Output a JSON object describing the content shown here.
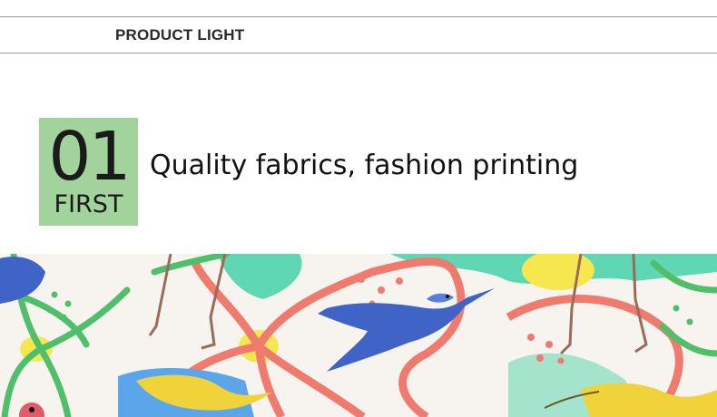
{
  "header": {
    "section_title": "PRODUCT LIGHT"
  },
  "feature": {
    "number": "01",
    "label": "FIRST",
    "headline": "Quality fabrics, fashion printing",
    "badge_color": "#a3d39c"
  },
  "fabric_image": {
    "description_icons": [
      "hummingbird-icon",
      "flamingo-leg-icon",
      "flower-icon",
      "leaf-icon"
    ]
  },
  "colors": {
    "rule": "#9a9a9a",
    "text": "#111111",
    "hummingbird_blue": "#3f63c6",
    "hummingbird_yellow": "#f0d23a",
    "flower_coral": "#f07a6e",
    "leaf_green": "#4fbf6a",
    "mint": "#5fd6b4"
  }
}
